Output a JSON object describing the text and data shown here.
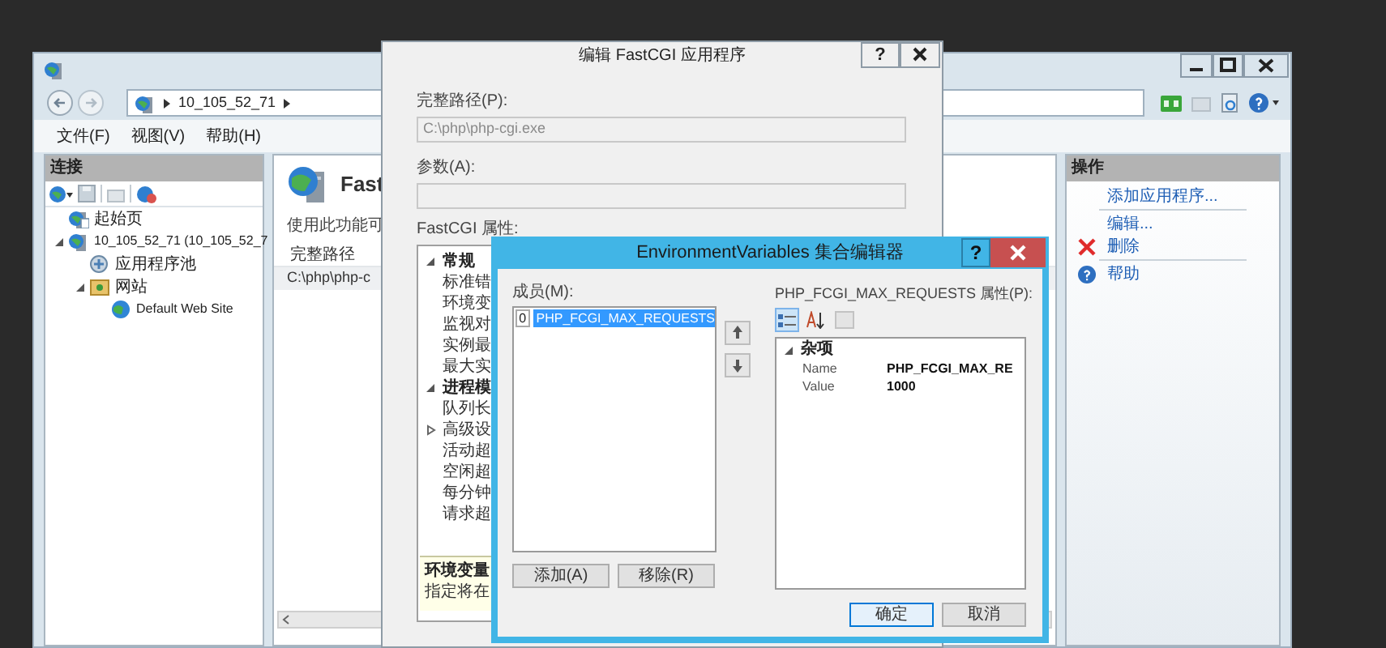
{
  "main_window": {
    "address_path": [
      "10_105_52_71"
    ],
    "menu": [
      "文件(F)",
      "视图(V)",
      "帮助(H)"
    ],
    "connections": {
      "title": "连接",
      "tree": [
        {
          "label": "起始页",
          "kind": "start"
        },
        {
          "label": "10_105_52_71 (10_105_52_7",
          "kind": "server",
          "expanded": true,
          "children": [
            {
              "label": "应用程序池",
              "kind": "pool"
            },
            {
              "label": "网站",
              "kind": "sites",
              "expanded": true,
              "children": [
                {
                  "label": "Default Web Site",
                  "kind": "site"
                }
              ]
            }
          ]
        }
      ]
    },
    "feature": {
      "title": "Fast",
      "description": "使用此功能可",
      "columns": [
        "完整路径"
      ],
      "rows": [
        [
          "C:\\php\\php-c"
        ]
      ]
    },
    "actions": {
      "title": "操作",
      "groups": [
        [
          {
            "label": "添加应用程序...",
            "kind": "plain"
          }
        ],
        [
          {
            "label": "编辑...",
            "kind": "plain"
          },
          {
            "label": "删除",
            "kind": "delete"
          }
        ],
        [
          {
            "label": "帮助",
            "kind": "help"
          }
        ]
      ]
    }
  },
  "edit_dialog": {
    "title": "编辑 FastCGI 应用程序",
    "help_button": "?",
    "full_path": {
      "label": "完整路径(P):",
      "value": "C:\\php\\php-cgi.exe",
      "disabled": true
    },
    "arguments": {
      "label": "参数(A):",
      "disabled": true
    },
    "properties_label": "FastCGI 属性:",
    "properties": [
      {
        "label": "常规",
        "expanded": true,
        "children": [
          {
            "label": "标准错"
          },
          {
            "label": "环境变"
          },
          {
            "label": "监视对"
          },
          {
            "label": "实例最"
          },
          {
            "label": "最大实"
          }
        ]
      },
      {
        "label": "进程模",
        "expanded": true,
        "children": [
          {
            "label": "队列长"
          },
          {
            "label": "高级设",
            "expanded": false
          },
          {
            "label": "活动超"
          },
          {
            "label": "空闲超"
          },
          {
            "label": "每分钟"
          },
          {
            "label": "请求超"
          }
        ]
      }
    ],
    "description": {
      "title": "环境变量",
      "text": "指定将在"
    }
  },
  "env_dialog": {
    "title": "EnvironmentVariables 集合编辑器",
    "help_button": "?",
    "members_label": "成员(M):",
    "members": [
      {
        "index": "0",
        "name": "PHP_FCGI_MAX_REQUESTS",
        "selected": true
      }
    ],
    "add_button": "添加(A)",
    "remove_button": "移除(R)",
    "properties_label": "PHP_FCGI_MAX_REQUESTS 属性(P):",
    "toolbar": [
      {
        "kind": "categorized",
        "selected": true
      },
      {
        "kind": "alphabetical",
        "selected": false
      }
    ],
    "grid": {
      "category": "杂项",
      "expanded": true,
      "rows": [
        {
          "name": "Name",
          "value": "PHP_FCGI_MAX_RE"
        },
        {
          "name": "Value",
          "value": "1000"
        }
      ]
    },
    "buttons": [
      "确定",
      "取消"
    ]
  }
}
